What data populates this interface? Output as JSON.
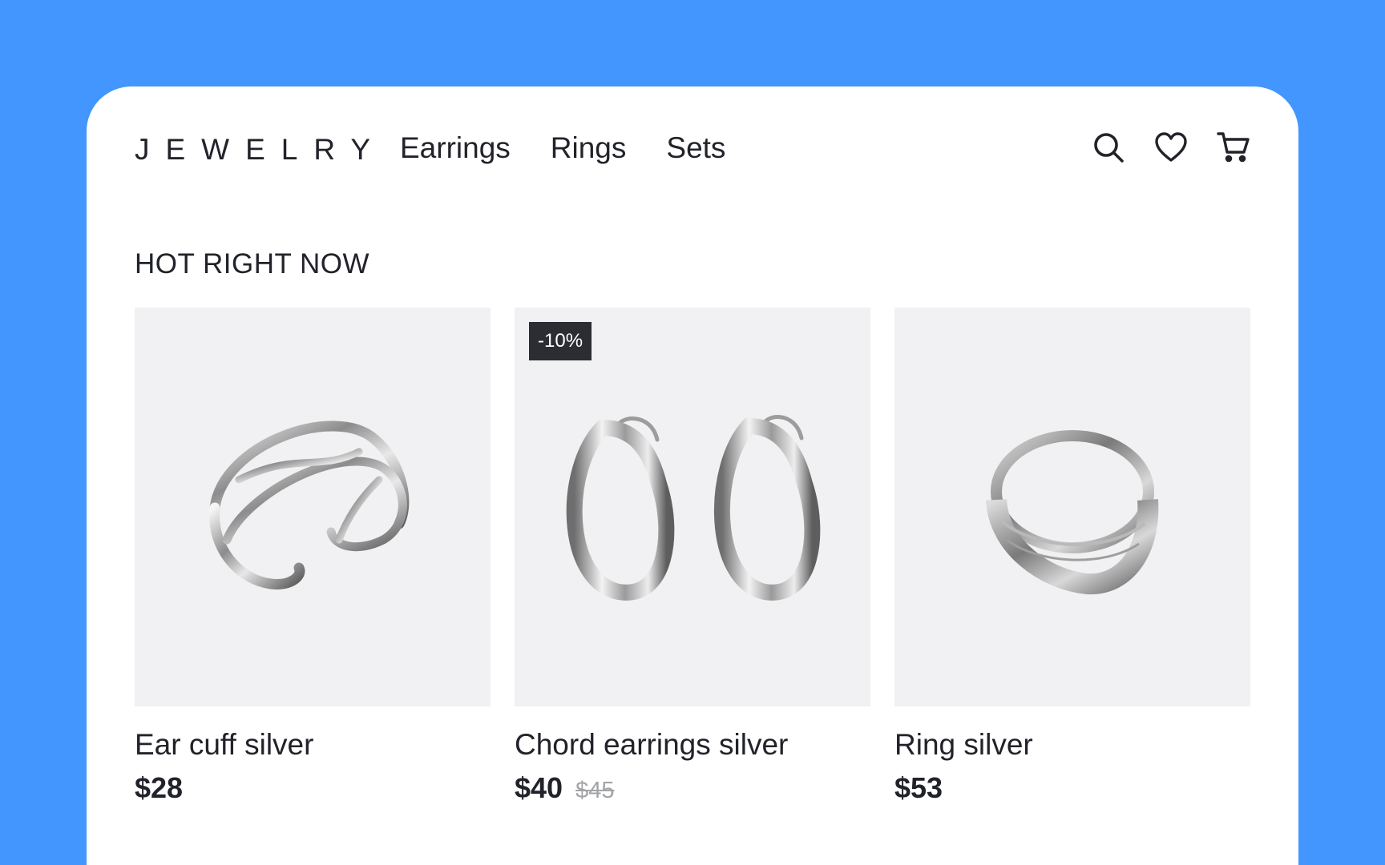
{
  "header": {
    "logo": "JEWELRY",
    "nav": [
      {
        "label": "Earrings"
      },
      {
        "label": "Rings"
      },
      {
        "label": "Sets"
      }
    ],
    "icons": [
      "search-icon",
      "heart-icon",
      "cart-icon"
    ]
  },
  "section": {
    "title": "HOT RIGHT NOW"
  },
  "products": [
    {
      "name": "Ear cuff silver",
      "price": "$28",
      "old_price": null,
      "badge": null
    },
    {
      "name": "Chord earrings silver",
      "price": "$40",
      "old_price": "$45",
      "badge": "-10%"
    },
    {
      "name": "Ring silver",
      "price": "$53",
      "old_price": null,
      "badge": null
    }
  ],
  "colors": {
    "background": "#4396fd",
    "card": "#ffffff",
    "text": "#22232a",
    "image_bg": "#f1f1f3",
    "badge_bg": "#2c2d33",
    "old_price": "#a3a4a8"
  }
}
